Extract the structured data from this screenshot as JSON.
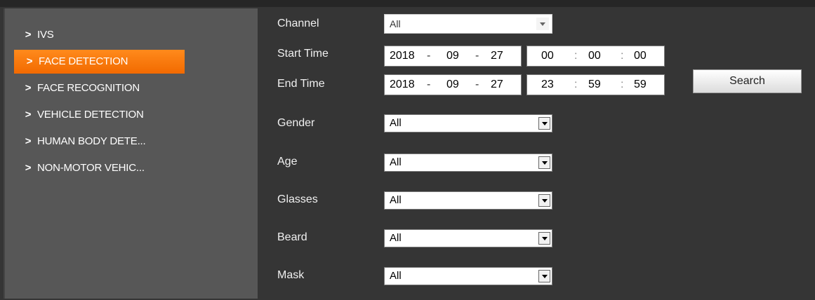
{
  "sidebar": {
    "items": [
      {
        "label": "IVS",
        "active": false
      },
      {
        "label": "FACE DETECTION",
        "active": true
      },
      {
        "label": "FACE RECOGNITION",
        "active": false
      },
      {
        "label": "VEHICLE DETECTION",
        "active": false
      },
      {
        "label": "HUMAN BODY DETE...",
        "active": false
      },
      {
        "label": "NON-MOTOR VEHIC...",
        "active": false
      }
    ]
  },
  "form": {
    "channel": {
      "label": "Channel",
      "value": "All"
    },
    "start_time": {
      "label": "Start Time",
      "year": "2018",
      "month": "09",
      "day": "27",
      "hour": "00",
      "minute": "00",
      "second": "00"
    },
    "end_time": {
      "label": "End Time",
      "year": "2018",
      "month": "09",
      "day": "27",
      "hour": "23",
      "minute": "59",
      "second": "59"
    },
    "date_sep": "-",
    "time_sep": ":",
    "search_label": "Search",
    "gender": {
      "label": "Gender",
      "value": "All"
    },
    "age": {
      "label": "Age",
      "value": "All"
    },
    "glasses": {
      "label": "Glasses",
      "value": "All"
    },
    "beard": {
      "label": "Beard",
      "value": "All"
    },
    "mask": {
      "label": "Mask",
      "value": "All"
    }
  },
  "colors": {
    "accent": "#f57c0e",
    "sidebar": "#575757",
    "background": "#353535"
  }
}
